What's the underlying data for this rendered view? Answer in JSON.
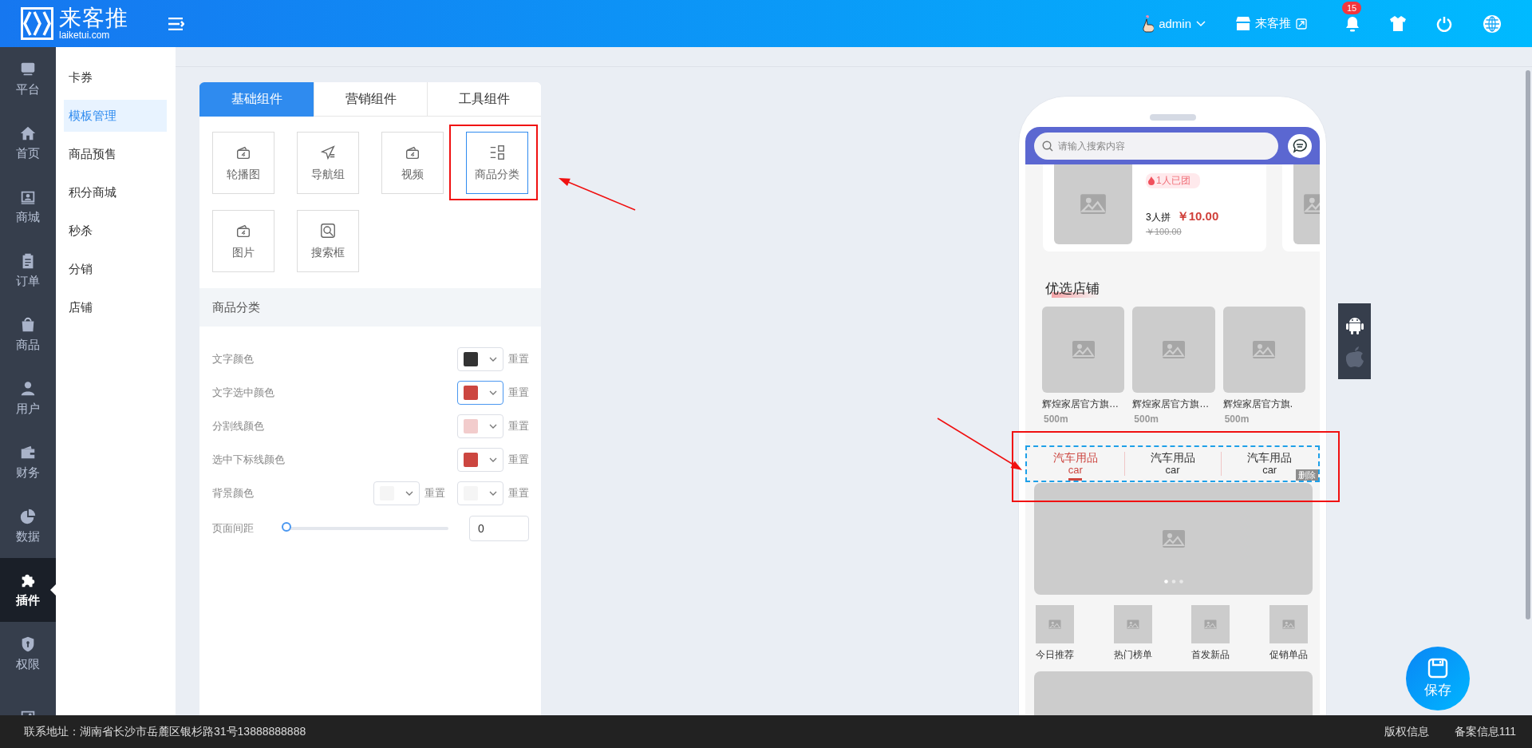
{
  "header": {
    "logo_title": "来客推",
    "logo_subtitle": "laiketui.com",
    "user": "admin",
    "store": "来客推",
    "notification_count": "15"
  },
  "rail": [
    {
      "label": "平台",
      "kind": "platform",
      "selected": false
    },
    {
      "label": "首页",
      "kind": "home",
      "selected": false
    },
    {
      "label": "商城",
      "kind": "mall",
      "selected": false
    },
    {
      "label": "订单",
      "kind": "order",
      "selected": false
    },
    {
      "label": "商品",
      "kind": "goods",
      "selected": false
    },
    {
      "label": "用户",
      "kind": "user",
      "selected": false
    },
    {
      "label": "财务",
      "kind": "finance",
      "selected": false
    },
    {
      "label": "数据",
      "kind": "data",
      "selected": false
    },
    {
      "label": "插件",
      "kind": "plugin",
      "selected": true
    },
    {
      "label": "权限",
      "kind": "permission",
      "selected": false
    },
    {
      "kind": "picture",
      "selected": false
    }
  ],
  "submenu": [
    {
      "label": "卡券",
      "selected": false
    },
    {
      "label": "模板管理",
      "selected": true
    },
    {
      "label": "商品预售",
      "selected": false
    },
    {
      "label": "积分商城",
      "selected": false
    },
    {
      "label": "秒杀",
      "selected": false
    },
    {
      "label": "分销",
      "selected": false
    },
    {
      "label": "店铺",
      "selected": false
    }
  ],
  "panel": {
    "tabs": [
      {
        "label": "基础组件",
        "selected": true
      },
      {
        "label": "营销组件",
        "selected": false
      },
      {
        "label": "工具组件",
        "selected": false
      }
    ],
    "components": [
      {
        "label": "轮播图",
        "kind": "image",
        "selected": false
      },
      {
        "label": "导航组",
        "kind": "navigation",
        "selected": false
      },
      {
        "label": "视频",
        "kind": "image",
        "selected": false
      },
      {
        "label": "商品分类",
        "kind": "category",
        "selected": true
      },
      {
        "label": "图片",
        "kind": "image",
        "selected": false
      },
      {
        "label": "搜索框",
        "kind": "search",
        "selected": false
      }
    ],
    "section_title": "商品分类",
    "properties": [
      {
        "label": "文字颜色",
        "pickers": [
          {
            "color": "#333333",
            "focused": false,
            "reset": "重置"
          }
        ]
      },
      {
        "label": "文字选中颜色",
        "pickers": [
          {
            "color": "#cc4640",
            "focused": true,
            "reset": "重置"
          }
        ]
      },
      {
        "label": "分割线颜色",
        "pickers": [
          {
            "color": "#f2cccc",
            "focused": false,
            "reset": "重置"
          }
        ]
      },
      {
        "label": "选中下标线颜色",
        "pickers": [
          {
            "color": "#cc4640",
            "focused": false,
            "reset": "重置"
          }
        ]
      },
      {
        "label": "背景颜色",
        "pickers": [
          {
            "color": "#f5f5f5",
            "focused": false,
            "reset": "重置"
          },
          {
            "color": "#f5f5f5",
            "focused": false,
            "reset": "重置"
          }
        ]
      }
    ],
    "spacing": {
      "label": "页面间距",
      "level": 0,
      "value": "0"
    }
  },
  "phone": {
    "search_placeholder": "请输入搜索内容",
    "group_buy": {
      "badge": "1人已团",
      "group_size": "3人拼",
      "price": "￥10.00",
      "original_price": "￥100.00"
    },
    "stores_title": "优选店铺",
    "stores": [
      {
        "name": "辉煌家居官方旗…",
        "distance": "500m"
      },
      {
        "name": "辉煌家居官方旗…",
        "distance": "500m"
      },
      {
        "name": "辉煌家居官方旗.",
        "distance": "500m"
      }
    ],
    "category_tabs": [
      {
        "title": "汽车用品",
        "subtitle": "car",
        "selected": true
      },
      {
        "title": "汽车用品",
        "subtitle": "car",
        "selected": false
      },
      {
        "title": "汽车用品",
        "subtitle": "car",
        "selected": false
      }
    ],
    "delete_label": "删除",
    "nav": [
      {
        "label": "今日推荐"
      },
      {
        "label": "热门榜单"
      },
      {
        "label": "首发新品"
      },
      {
        "label": "促销单品"
      }
    ],
    "save_label": "保存"
  },
  "footer": {
    "address": "联系地址：湖南省长沙市岳麓区银杉路31号13888888888",
    "links": [
      "版权信息",
      "备案信息111"
    ]
  }
}
